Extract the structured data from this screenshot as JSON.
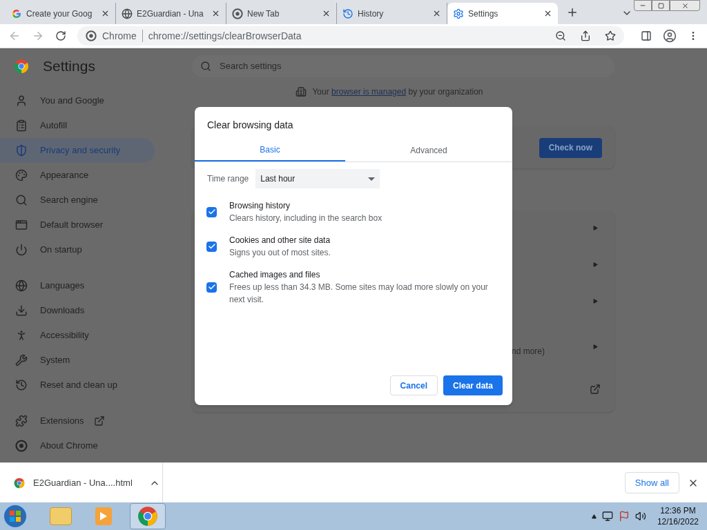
{
  "tabs": [
    {
      "title": "Create your Goog",
      "selected": false
    },
    {
      "title": "E2Guardian - Una",
      "selected": false
    },
    {
      "title": "New Tab",
      "selected": false
    },
    {
      "title": "History",
      "selected": false
    },
    {
      "title": "Settings",
      "selected": true
    }
  ],
  "toolbar": {
    "site_label": "Chrome",
    "url": "chrome://settings/clearBrowserData"
  },
  "settings": {
    "title": "Settings",
    "search_placeholder": "Search settings",
    "sidebar": [
      {
        "label": "You and Google",
        "selected": false
      },
      {
        "label": "Autofill",
        "selected": false
      },
      {
        "label": "Privacy and security",
        "selected": true
      },
      {
        "label": "Appearance",
        "selected": false
      },
      {
        "label": "Search engine",
        "selected": false
      },
      {
        "label": "Default browser",
        "selected": false
      },
      {
        "label": "On startup",
        "selected": false
      },
      {
        "label": "Languages",
        "selected": false
      },
      {
        "label": "Downloads",
        "selected": false
      },
      {
        "label": "Accessibility",
        "selected": false
      },
      {
        "label": "System",
        "selected": false
      },
      {
        "label": "Reset and clean up",
        "selected": false
      },
      {
        "label": "Extensions",
        "selected": false,
        "external": true
      },
      {
        "label": "About Chrome",
        "selected": false,
        "external": false
      }
    ],
    "managed_notice": {
      "before": "Your ",
      "link": "browser is managed",
      "after": " by your organization"
    },
    "check_button": "Check now",
    "partial_text": "nd more)"
  },
  "dialog": {
    "title": "Clear browsing data",
    "tabs": [
      {
        "label": "Basic",
        "selected": true
      },
      {
        "label": "Advanced",
        "selected": false
      }
    ],
    "time_range": {
      "label": "Time range",
      "value": "Last hour"
    },
    "options": [
      {
        "title": "Browsing history",
        "description": "Clears history, including in the search box",
        "checked": true
      },
      {
        "title": "Cookies and other site data",
        "description": "Signs you out of most sites.",
        "checked": true
      },
      {
        "title": "Cached images and files",
        "description": "Frees up less than 34.3 MB. Some sites may load more slowly on your next visit.",
        "checked": true
      }
    ],
    "cancel": "Cancel",
    "confirm": "Clear data"
  },
  "download_bar": {
    "file": "E2Guardian - Una....html",
    "show_all": "Show all"
  },
  "taskbar": {
    "time": "12:36 PM",
    "date": "12/16/2022"
  }
}
